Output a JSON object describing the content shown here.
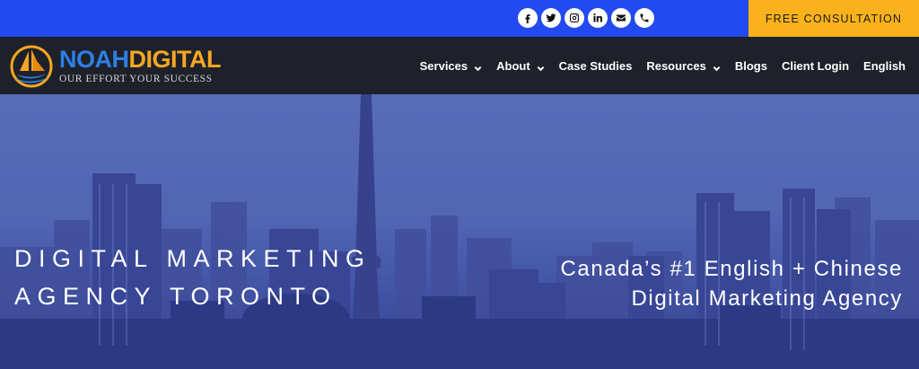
{
  "topbar": {
    "social": [
      {
        "name": "facebook-icon"
      },
      {
        "name": "twitter-icon"
      },
      {
        "name": "instagram-icon"
      },
      {
        "name": "linkedin-icon"
      },
      {
        "name": "email-icon"
      },
      {
        "name": "phone-icon"
      }
    ],
    "cta_label": "FREE CONSULTATION"
  },
  "logo": {
    "part1": "NOAH",
    "part2": "DIGITAL",
    "tagline": "OUR EFFORT YOUR SUCCESS"
  },
  "nav": {
    "items": [
      {
        "label": "Services",
        "dropdown": true
      },
      {
        "label": "About",
        "dropdown": true
      },
      {
        "label": "Case Studies",
        "dropdown": false
      },
      {
        "label": "Resources",
        "dropdown": true
      },
      {
        "label": "Blogs",
        "dropdown": false
      },
      {
        "label": "Client Login",
        "dropdown": false
      },
      {
        "label": "English",
        "dropdown": false
      }
    ]
  },
  "hero": {
    "heading_line1": "DIGITAL MARKETING",
    "heading_line2": "AGENCY TORONTO",
    "sub_line1": "Canada’s #1 English + Chinese",
    "sub_line2": "Digital Marketing Agency"
  },
  "colors": {
    "topbar": "#2349f0",
    "cta": "#f9b21b",
    "navbar": "#1e2129",
    "logo_blue": "#2d7fe6",
    "logo_orange": "#f5a623"
  }
}
